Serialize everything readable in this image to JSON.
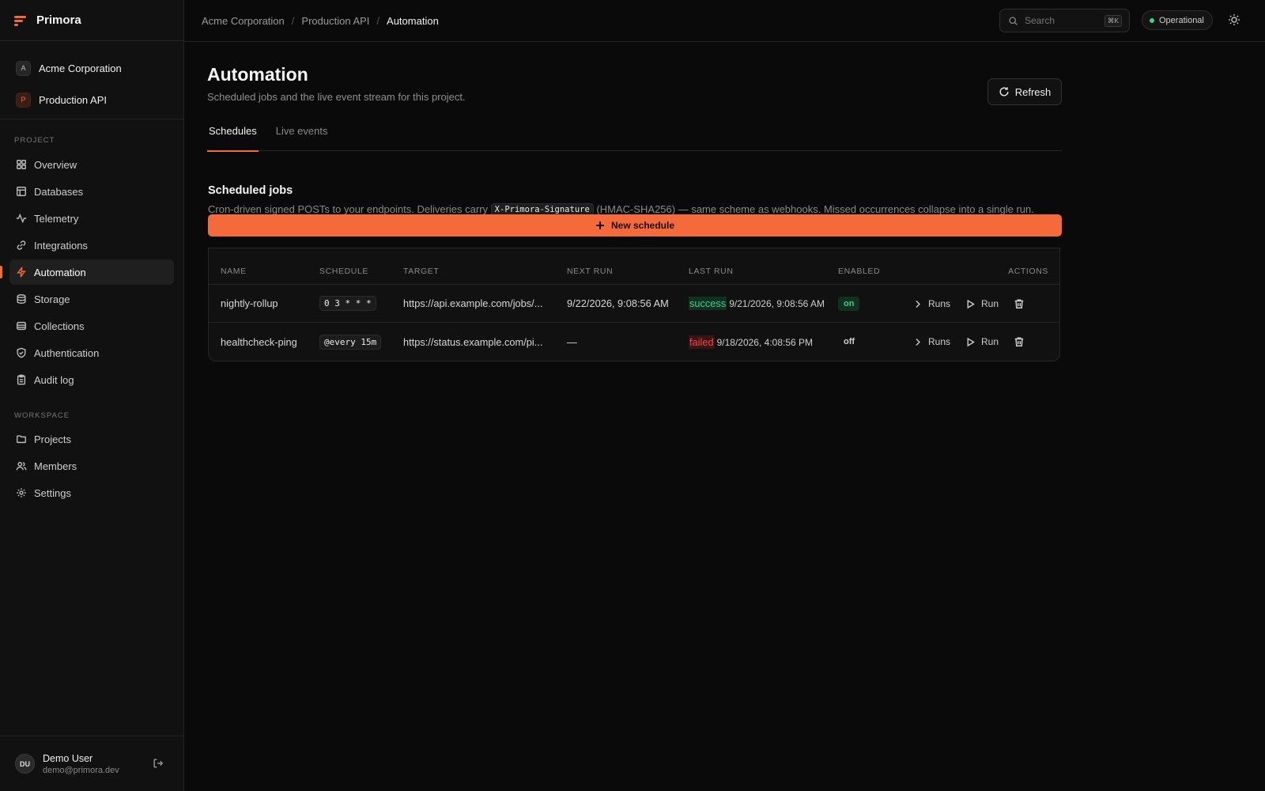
{
  "brand": {
    "name": "Primora"
  },
  "context": {
    "org": {
      "initial": "A",
      "name": "Acme Corporation"
    },
    "project": {
      "initial": "P",
      "name": "Production API"
    }
  },
  "nav": {
    "project_section": "PROJECT",
    "workspace_section": "WORKSPACE",
    "project_items": [
      {
        "label": "Overview",
        "icon": "grid-icon"
      },
      {
        "label": "Databases",
        "icon": "table-icon"
      },
      {
        "label": "Telemetry",
        "icon": "activity-icon"
      },
      {
        "label": "Integrations",
        "icon": "link-icon"
      },
      {
        "label": "Automation",
        "icon": "bolt-icon",
        "active": true
      },
      {
        "label": "Storage",
        "icon": "database-icon"
      },
      {
        "label": "Collections",
        "icon": "layers-icon"
      },
      {
        "label": "Authentication",
        "icon": "shield-icon"
      },
      {
        "label": "Audit log",
        "icon": "clipboard-icon"
      }
    ],
    "workspace_items": [
      {
        "label": "Projects",
        "icon": "folder-icon"
      },
      {
        "label": "Members",
        "icon": "users-icon"
      },
      {
        "label": "Settings",
        "icon": "gear-icon"
      }
    ]
  },
  "user": {
    "initials": "DU",
    "name": "Demo User",
    "email": "demo@primora.dev"
  },
  "topbar": {
    "breadcrumb": [
      "Acme Corporation",
      "Production API",
      "Automation"
    ],
    "search_placeholder": "Search",
    "search_shortcut": "⌘K",
    "status": "Operational",
    "status_color": "#3ecf8e"
  },
  "page": {
    "title": "Automation",
    "subtitle": "Scheduled jobs and the live event stream for this project.",
    "refresh_label": "Refresh",
    "tabs": [
      {
        "label": "Schedules",
        "active": true
      },
      {
        "label": "Live events",
        "active": false
      }
    ]
  },
  "card": {
    "title": "Scheduled jobs",
    "desc_before": "Cron-driven signed POSTs to your endpoints. Deliveries carry",
    "desc_code": "X-Primora-Signature",
    "desc_after": "(HMAC-SHA256) — same scheme as webhooks. Missed occurrences collapse into a single run.",
    "new_button": "New schedule",
    "accent": "#f46a3a"
  },
  "table": {
    "columns": [
      "NAME",
      "SCHEDULE",
      "TARGET",
      "NEXT RUN",
      "LAST RUN",
      "ENABLED",
      "ACTIONS"
    ],
    "rows": [
      {
        "name": "nightly-rollup",
        "schedule": "0 3 * * *",
        "target": "https://api.example.com/jobs/...",
        "next_run": "9/22/2026, 9:08:56 AM",
        "last_status": "success",
        "last_time": "9/21/2026, 9:08:56 AM",
        "enabled": "on",
        "runs_label": "Runs",
        "run_label": "Run"
      },
      {
        "name": "healthcheck-ping",
        "schedule": "@every 15m",
        "target": "https://status.example.com/pi...",
        "next_run": "—",
        "last_status": "failed",
        "last_time": "9/18/2026, 4:08:56 PM",
        "enabled": "off",
        "runs_label": "Runs",
        "run_label": "Run"
      }
    ]
  }
}
